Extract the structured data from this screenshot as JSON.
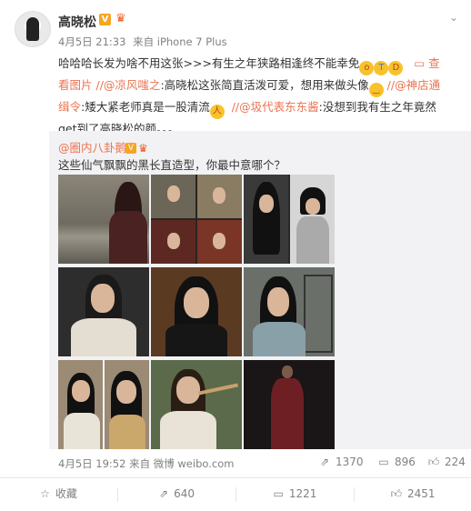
{
  "post": {
    "author": "高晓松",
    "time": "4月5日 21:33",
    "from_label": "来自",
    "device": "iPhone 7 Plus",
    "text_line1_a": "哈哈哈长发为啥不用这张>>>有生之年狭路相逢终不能幸免",
    "see_pic_a": "查",
    "see_pic_b": "看图片",
    "mention1": "//@凉风嗤之",
    "text2": ":高晓松这张简直活泼可爱，想用来做头像",
    "mention2": "//@神店通",
    "mention2b": "缉令",
    "text3": ":矮大紧老师真是一股清流",
    "mention3": "//@圾代表东东酱",
    "text4": ":没想到我有生之年竟然",
    "text5": "get到了高晓松的颜。。。"
  },
  "repost": {
    "author": "@圈内八卦鹅",
    "text": "这些仙气飘飘的黑长直造型，你最中意哪个？"
  },
  "footer": {
    "time": "4月5日 19:52",
    "from_label": "来自",
    "source": "微博 weibo.com",
    "reposts": "1370",
    "comments": "896",
    "likes": "224"
  },
  "actions": {
    "favorite": "收藏",
    "repost": "640",
    "comment": "1221",
    "like": "2451"
  },
  "icons": {
    "verified": "v-badge",
    "crown": "crown-icon",
    "menu": "chevron-down-icon"
  },
  "colors": {
    "link": "#eb7350",
    "verified": "#f5a623",
    "repost_bg": "#f2f2f5"
  }
}
